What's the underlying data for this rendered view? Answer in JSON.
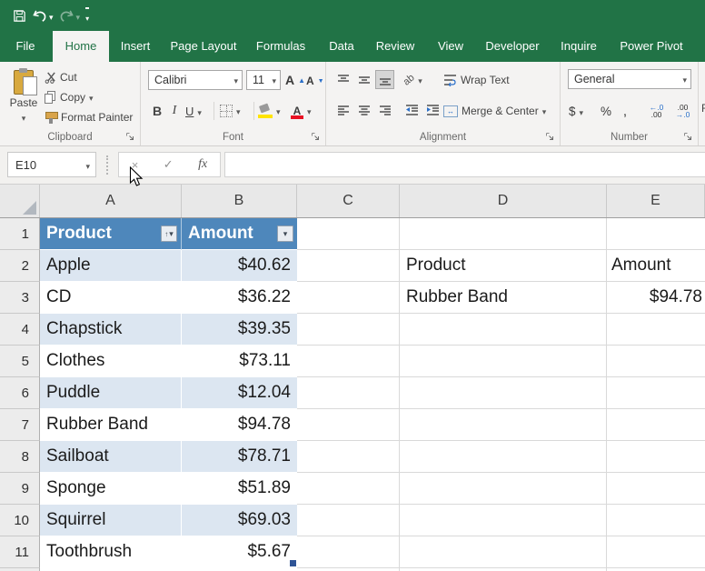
{
  "titlebar": {
    "bg": "#217346"
  },
  "tabs": [
    {
      "label": "File"
    },
    {
      "label": "Home",
      "active": true
    },
    {
      "label": "Insert"
    },
    {
      "label": "Page Layout"
    },
    {
      "label": "Formulas"
    },
    {
      "label": "Data"
    },
    {
      "label": "Review"
    },
    {
      "label": "View"
    },
    {
      "label": "Developer"
    },
    {
      "label": "Inquire"
    },
    {
      "label": "Power Pivot"
    }
  ],
  "ribbon": {
    "clipboard": {
      "label": "Clipboard",
      "paste": "Paste",
      "cut": "Cut",
      "copy": "Copy",
      "format_painter": "Format Painter"
    },
    "font": {
      "label": "Font",
      "family": "Calibri",
      "size": "11",
      "bold": "B",
      "italic": "I",
      "underline": "U",
      "grow": "A",
      "shrink": "A",
      "color_letter": "A"
    },
    "alignment": {
      "label": "Alignment",
      "wrap_text": "Wrap Text",
      "merge_center": "Merge & Center",
      "orientation": "ab"
    },
    "number": {
      "label": "Number",
      "format": "General",
      "currency": "$",
      "percent": "%",
      "comma": ",",
      "inc_top": "←.0",
      "inc_bottom": ".00",
      "dec_top": ".00",
      "dec_bottom": "→.0"
    },
    "next_group_partial": "F"
  },
  "formula_bar": {
    "name_box": "E10",
    "cancel": "×",
    "enter": "✓",
    "fx": "fx",
    "formula": ""
  },
  "sheet": {
    "columns": [
      "A",
      "B",
      "C",
      "D",
      "E"
    ],
    "header_row": {
      "n": "1",
      "product": "Product",
      "amount": "Amount"
    },
    "rows": [
      {
        "n": "2",
        "product": "Apple",
        "amount": "$40.62",
        "d": "Product",
        "e": "Amount"
      },
      {
        "n": "3",
        "product": "CD",
        "amount": "$36.22",
        "d": "Rubber Band",
        "e": "$94.78"
      },
      {
        "n": "4",
        "product": "Chapstick",
        "amount": "$39.35",
        "d": "",
        "e": ""
      },
      {
        "n": "5",
        "product": "Clothes",
        "amount": "$73.11",
        "d": "",
        "e": ""
      },
      {
        "n": "6",
        "product": "Puddle",
        "amount": "$12.04",
        "d": "",
        "e": ""
      },
      {
        "n": "7",
        "product": "Rubber Band",
        "amount": "$94.78",
        "d": "",
        "e": ""
      },
      {
        "n": "8",
        "product": "Sailboat",
        "amount": "$78.71",
        "d": "",
        "e": ""
      },
      {
        "n": "9",
        "product": "Sponge",
        "amount": "$51.89",
        "d": "",
        "e": ""
      },
      {
        "n": "10",
        "product": "Squirrel",
        "amount": "$69.03",
        "d": "",
        "e": ""
      },
      {
        "n": "11",
        "product": "Toothbrush",
        "amount": "$5.67",
        "d": "",
        "e": ""
      }
    ],
    "colors": {
      "table_header_bg": "#4e87bb",
      "band_bg": "#dce6f1",
      "titlebar_green": "#217346",
      "gridline": "#d9d9d9"
    }
  }
}
